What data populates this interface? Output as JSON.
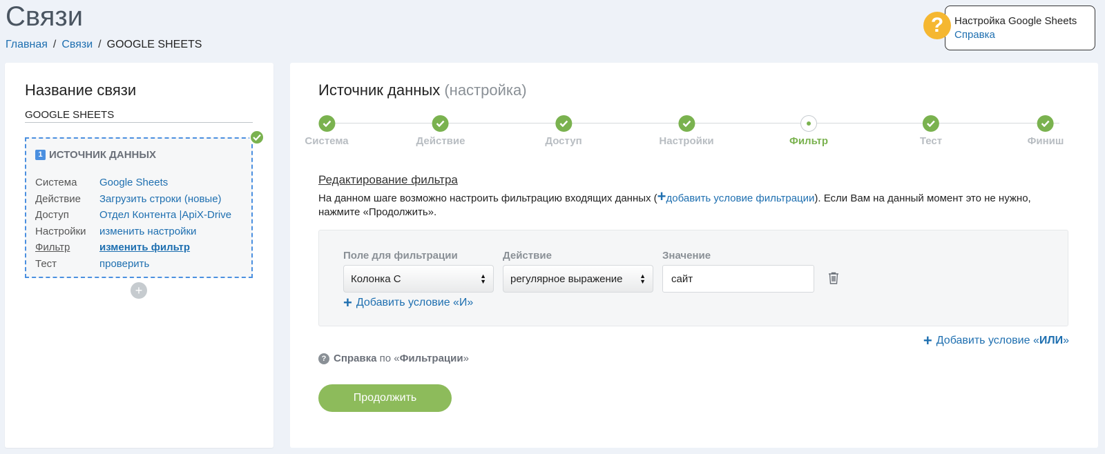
{
  "page": {
    "title": "Связи",
    "breadcrumb": [
      "Главная",
      "Связи",
      "GOOGLE SHEETS"
    ]
  },
  "help": {
    "icon": "?",
    "title": "Настройка Google Sheets",
    "link": "Справка"
  },
  "left": {
    "title": "Название связи",
    "connection_name": "GOOGLE SHEETS",
    "source": {
      "number": "1",
      "title": "ИСТОЧНИК ДАННЫХ",
      "rows": [
        {
          "key": "Система",
          "value": "Google Sheets"
        },
        {
          "key": "Действие",
          "value": "Загрузить строки (новые)"
        },
        {
          "key": "Доступ",
          "value": "Отдел Контента |ApiX-Drive"
        },
        {
          "key": "Настройки",
          "value": "изменить настройки"
        },
        {
          "key": "Фильтр",
          "value": "изменить фильтр"
        },
        {
          "key": "Тест",
          "value": "проверить"
        }
      ]
    },
    "add_icon": "+"
  },
  "main": {
    "title": "Источник данных",
    "title_sub": "(настройка)",
    "steps": [
      {
        "label": "Система",
        "state": "done"
      },
      {
        "label": "Действие",
        "state": "done"
      },
      {
        "label": "Доступ",
        "state": "done"
      },
      {
        "label": "Настройки",
        "state": "done"
      },
      {
        "label": "Фильтр",
        "state": "current"
      },
      {
        "label": "Тест",
        "state": "done"
      },
      {
        "label": "Финиш",
        "state": "done"
      }
    ],
    "edit_title": "Редактирование фильтра",
    "desc_before": "На данном шаге возможно настроить фильтрацию входящих данных (",
    "desc_link": "добавить условие фильтрации",
    "desc_after": "). Если Вам на данный момент это не нужно, нажмите «Продолжить».",
    "filter": {
      "field_label": "Поле для фильтрации",
      "action_label": "Действие",
      "value_label": "Значение",
      "field_value": "Колонка C",
      "action_value": "регулярное выражение",
      "value_value": "сайт",
      "add_and": "Добавить условие «И»"
    },
    "add_or_prefix": "Добавить условие «",
    "add_or_bold": "ИЛИ",
    "add_or_suffix": "»",
    "help_bold": "Справка",
    "help_mid": " по «",
    "help_bold2": "Фильтрации",
    "help_end": "»",
    "continue": "Продолжить"
  }
}
